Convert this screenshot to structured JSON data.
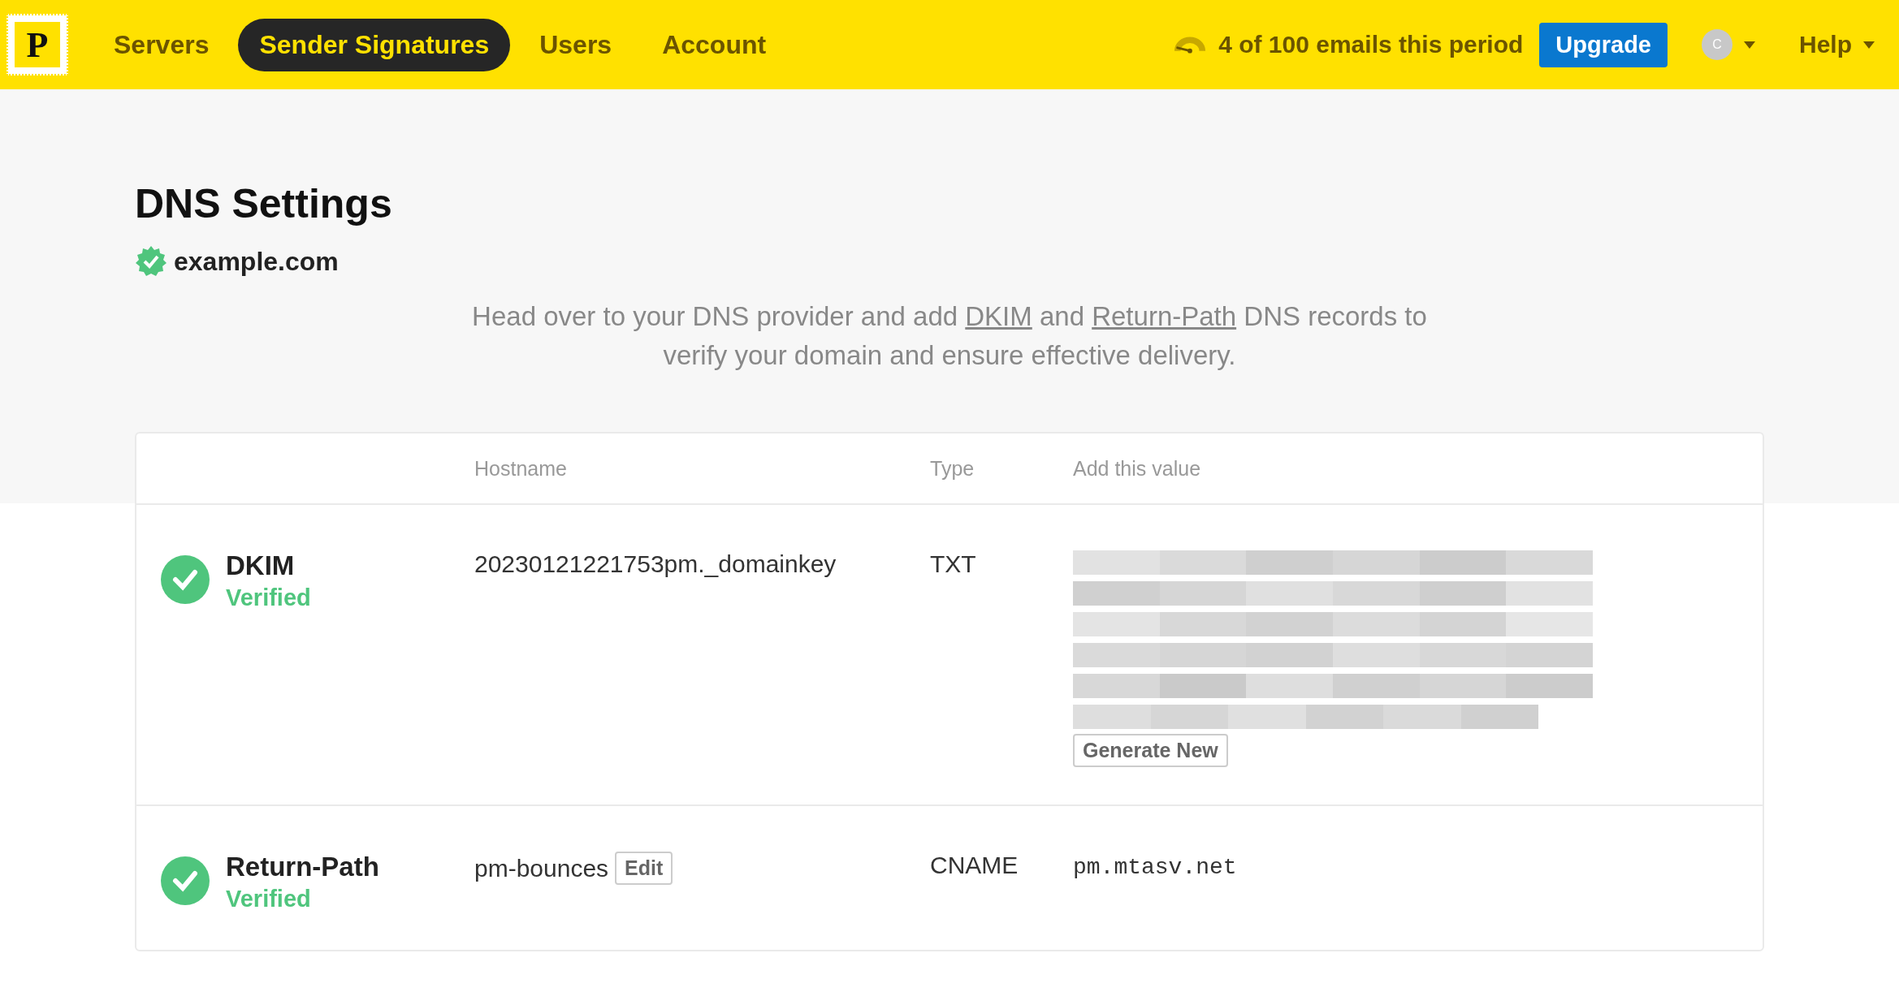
{
  "nav": {
    "logo": "P",
    "items": [
      {
        "label": "Servers",
        "selected": false
      },
      {
        "label": "Sender Signatures",
        "selected": true
      },
      {
        "label": "Users",
        "selected": false
      },
      {
        "label": "Account",
        "selected": false
      }
    ],
    "usage": "4 of 100 emails this period",
    "upgrade": "Upgrade",
    "avatar": "C",
    "help": "Help"
  },
  "page": {
    "title": "DNS Settings",
    "domain": "example.com",
    "domain_verified": true,
    "description": [
      {
        "text": "Head over to your DNS provider and add ",
        "link": false
      },
      {
        "text": "DKIM",
        "link": true
      },
      {
        "text": " and ",
        "link": false
      },
      {
        "text": "Return-Path",
        "link": true
      },
      {
        "text": " DNS records to verify your domain and ensure effective delivery.",
        "link": false
      }
    ]
  },
  "table": {
    "columns": [
      "Hostname",
      "Type",
      "Add this value"
    ],
    "rows": [
      {
        "name": "DKIM",
        "status": "Verified",
        "verified": true,
        "hostname": "20230121221753pm._domainkey",
        "type": "TXT",
        "kind": "blurred",
        "value_action": "Generate New"
      },
      {
        "name": "Return-Path",
        "status": "Verified",
        "verified": true,
        "hostname": "pm-bounces",
        "hostname_action": "Edit",
        "type": "CNAME",
        "kind": "text",
        "value": "pm.mtasv.net"
      }
    ]
  }
}
